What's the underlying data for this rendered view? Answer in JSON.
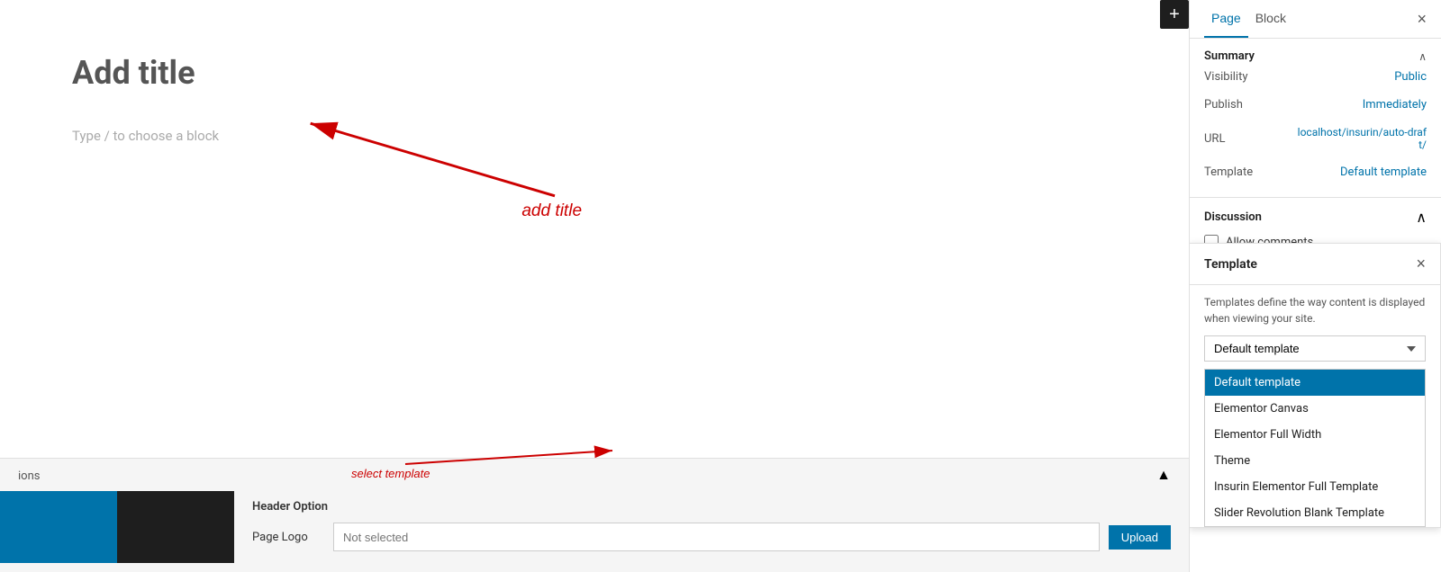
{
  "tabs": {
    "page_label": "Page",
    "block_label": "Block"
  },
  "summary": {
    "title": "Summary",
    "visibility_label": "Visibility",
    "visibility_value": "Public",
    "publish_label": "Publish",
    "publish_value": "Immediately",
    "url_label": "URL",
    "url_value": "localhost/insurin/auto-draft/",
    "template_label": "Template",
    "template_value": "Default template"
  },
  "template_popup": {
    "title": "Template",
    "description": "Templates define the way content is displayed when viewing your site.",
    "selected": "Default template",
    "options": [
      "Default template",
      "Elementor Canvas",
      "Elementor Full Width",
      "Theme",
      "Insurin Elementor Full Template",
      "Slider Revolution Blank Template"
    ]
  },
  "discussion": {
    "title": "Discussion",
    "allow_comments_label": "Allow comments"
  },
  "editor": {
    "add_title_placeholder": "Add title",
    "block_placeholder": "Type / to choose a block",
    "add_title_annotation": "add title",
    "select_template_annotation": "select template"
  },
  "bottom_panel": {
    "header_option_title": "Header Option",
    "page_logo_label": "Page Logo",
    "page_logo_placeholder": "Not selected",
    "upload_label": "Upload"
  },
  "icons": {
    "plus": "+",
    "close": "×",
    "chevron_up": "∧",
    "chevron_down": "∨"
  }
}
